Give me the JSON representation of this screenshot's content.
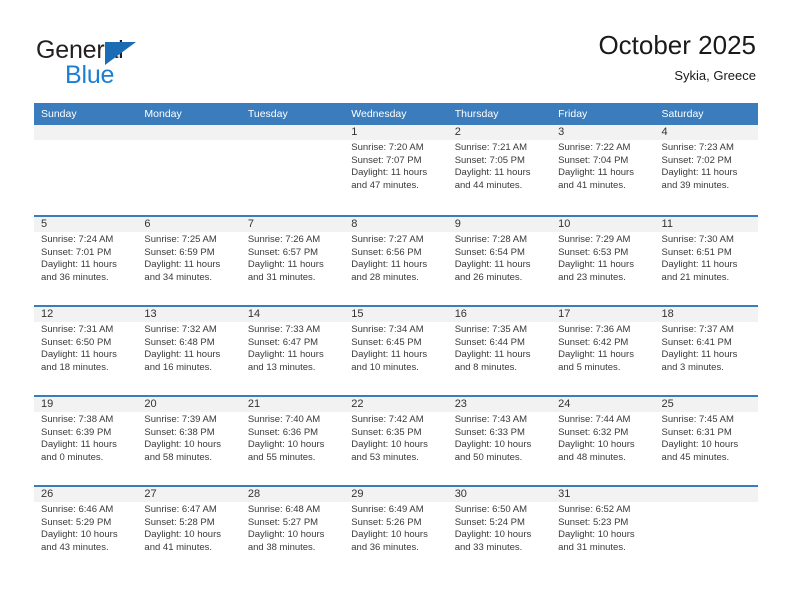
{
  "brand": {
    "name_top": "General",
    "name_bottom": "Blue",
    "accent_color": "#1b7fd4",
    "triangle_color": "#1b6cb5"
  },
  "header": {
    "month_title": "October 2025",
    "location": "Sykia, Greece"
  },
  "calendar": {
    "header_bg": "#3b7cbd",
    "daynum_bg": "#f2f2f2",
    "weekdays": [
      "Sunday",
      "Monday",
      "Tuesday",
      "Wednesday",
      "Thursday",
      "Friday",
      "Saturday"
    ],
    "weeks": [
      [
        {
          "day": "",
          "sunrise": "",
          "sunset": "",
          "daylight1": "",
          "daylight2": "",
          "empty": true
        },
        {
          "day": "",
          "sunrise": "",
          "sunset": "",
          "daylight1": "",
          "daylight2": "",
          "empty": true
        },
        {
          "day": "",
          "sunrise": "",
          "sunset": "",
          "daylight1": "",
          "daylight2": "",
          "empty": true
        },
        {
          "day": "1",
          "sunrise": "Sunrise: 7:20 AM",
          "sunset": "Sunset: 7:07 PM",
          "daylight1": "Daylight: 11 hours",
          "daylight2": "and 47 minutes."
        },
        {
          "day": "2",
          "sunrise": "Sunrise: 7:21 AM",
          "sunset": "Sunset: 7:05 PM",
          "daylight1": "Daylight: 11 hours",
          "daylight2": "and 44 minutes."
        },
        {
          "day": "3",
          "sunrise": "Sunrise: 7:22 AM",
          "sunset": "Sunset: 7:04 PM",
          "daylight1": "Daylight: 11 hours",
          "daylight2": "and 41 minutes."
        },
        {
          "day": "4",
          "sunrise": "Sunrise: 7:23 AM",
          "sunset": "Sunset: 7:02 PM",
          "daylight1": "Daylight: 11 hours",
          "daylight2": "and 39 minutes."
        }
      ],
      [
        {
          "day": "5",
          "sunrise": "Sunrise: 7:24 AM",
          "sunset": "Sunset: 7:01 PM",
          "daylight1": "Daylight: 11 hours",
          "daylight2": "and 36 minutes."
        },
        {
          "day": "6",
          "sunrise": "Sunrise: 7:25 AM",
          "sunset": "Sunset: 6:59 PM",
          "daylight1": "Daylight: 11 hours",
          "daylight2": "and 34 minutes."
        },
        {
          "day": "7",
          "sunrise": "Sunrise: 7:26 AM",
          "sunset": "Sunset: 6:57 PM",
          "daylight1": "Daylight: 11 hours",
          "daylight2": "and 31 minutes."
        },
        {
          "day": "8",
          "sunrise": "Sunrise: 7:27 AM",
          "sunset": "Sunset: 6:56 PM",
          "daylight1": "Daylight: 11 hours",
          "daylight2": "and 28 minutes."
        },
        {
          "day": "9",
          "sunrise": "Sunrise: 7:28 AM",
          "sunset": "Sunset: 6:54 PM",
          "daylight1": "Daylight: 11 hours",
          "daylight2": "and 26 minutes."
        },
        {
          "day": "10",
          "sunrise": "Sunrise: 7:29 AM",
          "sunset": "Sunset: 6:53 PM",
          "daylight1": "Daylight: 11 hours",
          "daylight2": "and 23 minutes."
        },
        {
          "day": "11",
          "sunrise": "Sunrise: 7:30 AM",
          "sunset": "Sunset: 6:51 PM",
          "daylight1": "Daylight: 11 hours",
          "daylight2": "and 21 minutes."
        }
      ],
      [
        {
          "day": "12",
          "sunrise": "Sunrise: 7:31 AM",
          "sunset": "Sunset: 6:50 PM",
          "daylight1": "Daylight: 11 hours",
          "daylight2": "and 18 minutes."
        },
        {
          "day": "13",
          "sunrise": "Sunrise: 7:32 AM",
          "sunset": "Sunset: 6:48 PM",
          "daylight1": "Daylight: 11 hours",
          "daylight2": "and 16 minutes."
        },
        {
          "day": "14",
          "sunrise": "Sunrise: 7:33 AM",
          "sunset": "Sunset: 6:47 PM",
          "daylight1": "Daylight: 11 hours",
          "daylight2": "and 13 minutes."
        },
        {
          "day": "15",
          "sunrise": "Sunrise: 7:34 AM",
          "sunset": "Sunset: 6:45 PM",
          "daylight1": "Daylight: 11 hours",
          "daylight2": "and 10 minutes."
        },
        {
          "day": "16",
          "sunrise": "Sunrise: 7:35 AM",
          "sunset": "Sunset: 6:44 PM",
          "daylight1": "Daylight: 11 hours",
          "daylight2": "and 8 minutes."
        },
        {
          "day": "17",
          "sunrise": "Sunrise: 7:36 AM",
          "sunset": "Sunset: 6:42 PM",
          "daylight1": "Daylight: 11 hours",
          "daylight2": "and 5 minutes."
        },
        {
          "day": "18",
          "sunrise": "Sunrise: 7:37 AM",
          "sunset": "Sunset: 6:41 PM",
          "daylight1": "Daylight: 11 hours",
          "daylight2": "and 3 minutes."
        }
      ],
      [
        {
          "day": "19",
          "sunrise": "Sunrise: 7:38 AM",
          "sunset": "Sunset: 6:39 PM",
          "daylight1": "Daylight: 11 hours",
          "daylight2": "and 0 minutes."
        },
        {
          "day": "20",
          "sunrise": "Sunrise: 7:39 AM",
          "sunset": "Sunset: 6:38 PM",
          "daylight1": "Daylight: 10 hours",
          "daylight2": "and 58 minutes."
        },
        {
          "day": "21",
          "sunrise": "Sunrise: 7:40 AM",
          "sunset": "Sunset: 6:36 PM",
          "daylight1": "Daylight: 10 hours",
          "daylight2": "and 55 minutes."
        },
        {
          "day": "22",
          "sunrise": "Sunrise: 7:42 AM",
          "sunset": "Sunset: 6:35 PM",
          "daylight1": "Daylight: 10 hours",
          "daylight2": "and 53 minutes."
        },
        {
          "day": "23",
          "sunrise": "Sunrise: 7:43 AM",
          "sunset": "Sunset: 6:33 PM",
          "daylight1": "Daylight: 10 hours",
          "daylight2": "and 50 minutes."
        },
        {
          "day": "24",
          "sunrise": "Sunrise: 7:44 AM",
          "sunset": "Sunset: 6:32 PM",
          "daylight1": "Daylight: 10 hours",
          "daylight2": "and 48 minutes."
        },
        {
          "day": "25",
          "sunrise": "Sunrise: 7:45 AM",
          "sunset": "Sunset: 6:31 PM",
          "daylight1": "Daylight: 10 hours",
          "daylight2": "and 45 minutes."
        }
      ],
      [
        {
          "day": "26",
          "sunrise": "Sunrise: 6:46 AM",
          "sunset": "Sunset: 5:29 PM",
          "daylight1": "Daylight: 10 hours",
          "daylight2": "and 43 minutes."
        },
        {
          "day": "27",
          "sunrise": "Sunrise: 6:47 AM",
          "sunset": "Sunset: 5:28 PM",
          "daylight1": "Daylight: 10 hours",
          "daylight2": "and 41 minutes."
        },
        {
          "day": "28",
          "sunrise": "Sunrise: 6:48 AM",
          "sunset": "Sunset: 5:27 PM",
          "daylight1": "Daylight: 10 hours",
          "daylight2": "and 38 minutes."
        },
        {
          "day": "29",
          "sunrise": "Sunrise: 6:49 AM",
          "sunset": "Sunset: 5:26 PM",
          "daylight1": "Daylight: 10 hours",
          "daylight2": "and 36 minutes."
        },
        {
          "day": "30",
          "sunrise": "Sunrise: 6:50 AM",
          "sunset": "Sunset: 5:24 PM",
          "daylight1": "Daylight: 10 hours",
          "daylight2": "and 33 minutes."
        },
        {
          "day": "31",
          "sunrise": "Sunrise: 6:52 AM",
          "sunset": "Sunset: 5:23 PM",
          "daylight1": "Daylight: 10 hours",
          "daylight2": "and 31 minutes."
        },
        {
          "day": "",
          "sunrise": "",
          "sunset": "",
          "daylight1": "",
          "daylight2": "",
          "empty": true
        }
      ]
    ]
  }
}
